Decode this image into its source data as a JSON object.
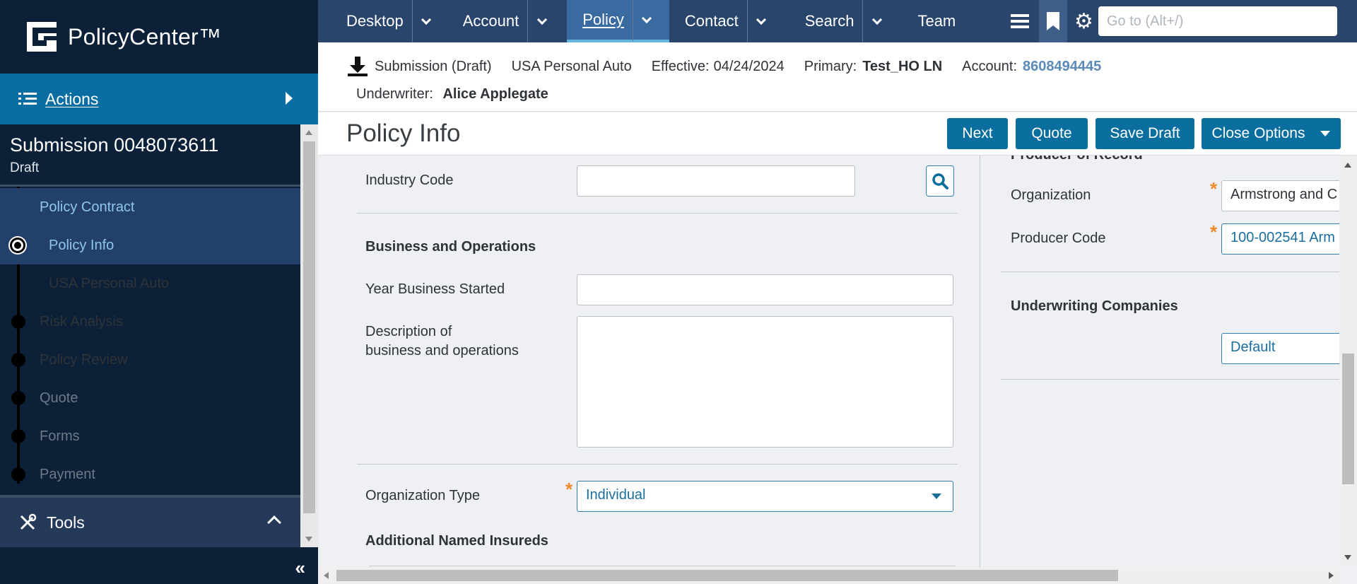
{
  "app": {
    "name": "PolicyCenter™"
  },
  "left_nav": {
    "actions_label": "Actions",
    "submission_title": "Submission 0048073611",
    "submission_status": "Draft",
    "steps": [
      {
        "label": "Policy Contract"
      },
      {
        "label": "Policy Info"
      },
      {
        "label": "USA Personal Auto"
      },
      {
        "label": "Risk Analysis"
      },
      {
        "label": "Policy Review"
      },
      {
        "label": "Quote"
      },
      {
        "label": "Forms"
      },
      {
        "label": "Payment"
      }
    ],
    "tools_label": "Tools"
  },
  "top_nav": {
    "tabs": [
      {
        "label": "Desktop"
      },
      {
        "label": "Account"
      },
      {
        "label": "Policy"
      },
      {
        "label": "Contact"
      },
      {
        "label": "Search"
      },
      {
        "label": "Team"
      }
    ],
    "goto_placeholder": "Go to (Alt+/)"
  },
  "info_bar": {
    "submission": "Submission (Draft)",
    "product": "USA Personal Auto",
    "effective_label": "Effective:",
    "effective_value": "04/24/2024",
    "primary_label": "Primary:",
    "primary_value": "Test_HO LN",
    "account_label": "Account:",
    "account_value": "8608494445",
    "underwriter_label": "Underwriter:",
    "underwriter_value": "Alice Applegate"
  },
  "page": {
    "title": "Policy Info",
    "buttons": {
      "next": "Next",
      "quote": "Quote",
      "save_draft": "Save Draft",
      "close_options": "Close Options"
    }
  },
  "form": {
    "industry_code_label": "Industry Code",
    "industry_code_value": "",
    "business_ops_header": "Business and Operations",
    "year_started_label": "Year Business Started",
    "year_started_value": "",
    "description_label_1": "Description of",
    "description_label_2": "business and operations",
    "description_value": "",
    "org_type_label": "Organization Type",
    "org_type_value": "Individual",
    "additional_named_insureds": "Additional Named Insureds"
  },
  "right_panel": {
    "producer_header": "Producer of Record",
    "organization_label": "Organization",
    "organization_value": "Armstrong and C",
    "producer_code_label": "Producer Code",
    "producer_code_value": "100-002541 Arm",
    "underwriting_header": "Underwriting Companies",
    "underwriting_value": "Default"
  },
  "colors": {
    "nav_dark": "#0c2038",
    "accent": "#0a6ea2",
    "link": "#5b8ab8",
    "required": "#ee8a2b"
  }
}
